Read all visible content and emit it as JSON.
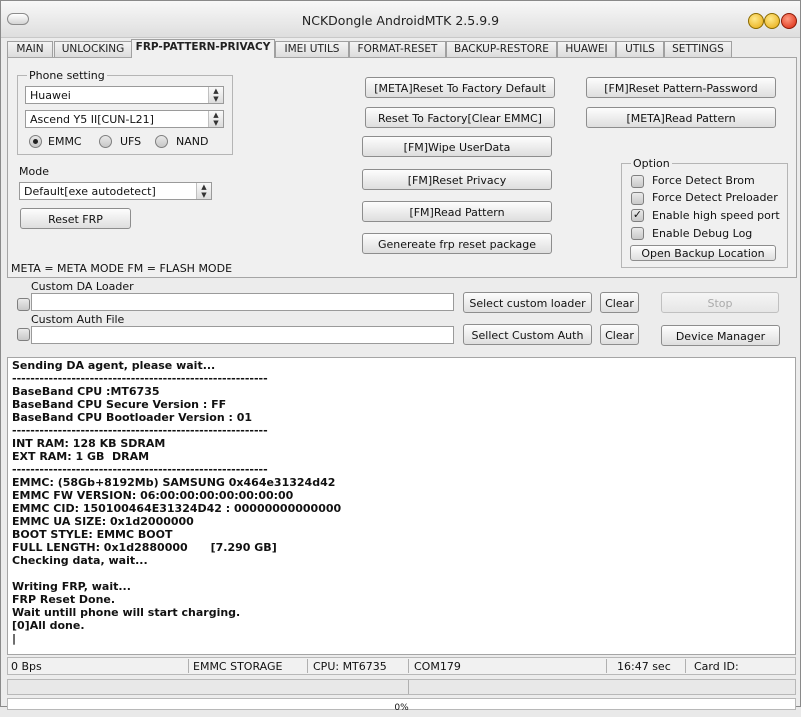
{
  "window": {
    "title": "NCKDongle AndroidMTK 2.5.9.9"
  },
  "tabs": [
    "MAIN",
    "UNLOCKING",
    "FRP-PATTERN-PRIVACY",
    "IMEI UTILS",
    "FORMAT-RESET",
    "BACKUP-RESTORE",
    "HUAWEI",
    "UTILS",
    "SETTINGS"
  ],
  "phone_setting": {
    "label": "Phone setting",
    "brand": "Huawei",
    "model": "Ascend Y5 II[CUN-L21]",
    "storage": {
      "emmc": "EMMC",
      "ufs": "UFS",
      "nand": "NAND",
      "selected": "EMMC"
    }
  },
  "mode": {
    "label": "Mode",
    "value": "Default[exe autodetect]"
  },
  "buttons": {
    "reset_frp": "Reset FRP",
    "meta_reset_factory": "[META]Reset To Factory Default",
    "reset_factory_clear": "Reset To Factory[Clear EMMC]",
    "fm_wipe": "[FM]Wipe UserData",
    "fm_reset_privacy": "[FM]Reset Privacy",
    "fm_read_pattern_mid": "[FM]Read Pattern",
    "generate_frp": "Genereate frp reset package",
    "fm_reset_pattern_pwd": "[FM]Reset Pattern-Password",
    "meta_read_pattern": "[META]Read Pattern",
    "select_custom_loader": "Select custom loader",
    "clear1": "Clear",
    "stop": "Stop",
    "select_custom_auth": "Sellect Custom Auth",
    "clear2": "Clear",
    "device_manager": "Device Manager",
    "open_backup": "Open Backup Location"
  },
  "options": {
    "label": "Option",
    "items": [
      {
        "label": "Force Detect Brom",
        "checked": false
      },
      {
        "label": "Force Detect Preloader",
        "checked": false
      },
      {
        "label": "Enable high speed port",
        "checked": true
      },
      {
        "label": "Enable Debug Log",
        "checked": false
      }
    ]
  },
  "legend": "META = META MODE     FM = FLASH MODE",
  "custom_da": {
    "label": "Custom DA Loader",
    "value": ""
  },
  "custom_auth": {
    "label": "Custom Auth File",
    "value": ""
  },
  "log": [
    "Sending DA agent, please wait...",
    "--------------------------------------------------------",
    "BaseBand CPU :MT6735",
    "BaseBand CPU Secure Version : FF",
    "BaseBand CPU Bootloader Version : 01",
    "--------------------------------------------------------",
    "INT RAM: 128 KB SDRAM",
    "EXT RAM: 1 GB  DRAM",
    "--------------------------------------------------------",
    "EMMC: (58Gb+8192Mb) SAMSUNG 0x464e31324d42",
    "EMMC FW VERSION: 06:00:00:00:00:00:00:00",
    "EMMC CID: 150100464E31324D42 : 00000000000000",
    "EMMC UA SIZE: 0x1d2000000",
    "BOOT STYLE: EMMC BOOT",
    "FULL LENGTH: 0x1d2880000      [7.290 GB]",
    "Checking data, wait...",
    "",
    "Writing FRP, wait...",
    "FRP Reset Done.",
    "Wait untill phone will start charging.",
    "[0]All done.",
    "|"
  ],
  "status": {
    "speed": "0 Bps",
    "storage": "EMMC STORAGE",
    "cpu": "CPU: MT6735",
    "com": "COM179",
    "time": "16:47 sec",
    "card": "Card ID:"
  },
  "progress": {
    "percent": 0,
    "label": "0%"
  }
}
